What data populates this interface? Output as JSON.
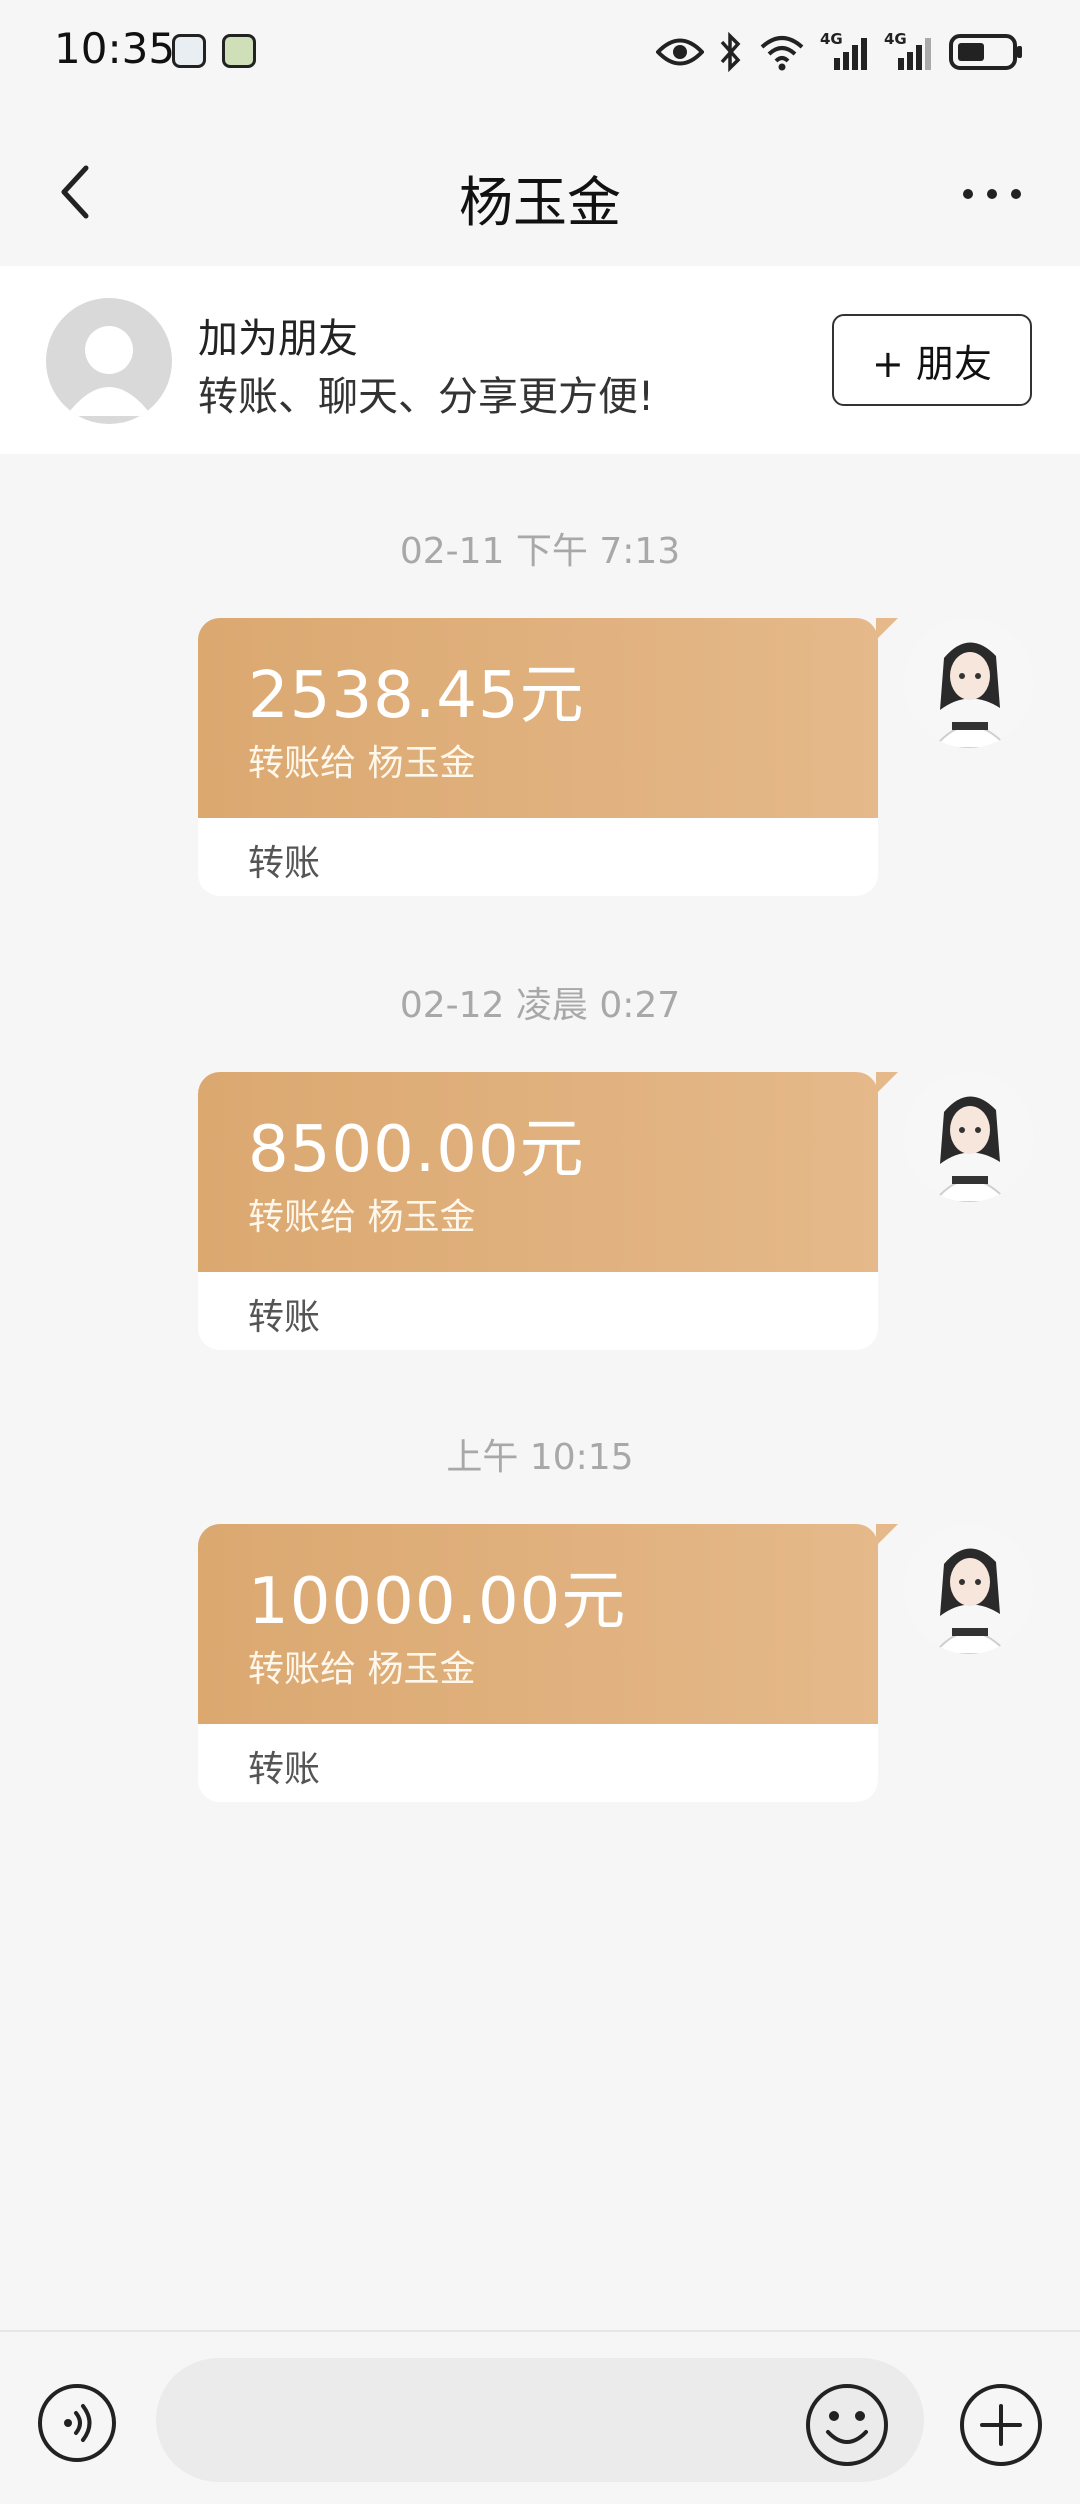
{
  "status_bar": {
    "time": "10:35",
    "network1": "4G",
    "network2": "4G"
  },
  "nav": {
    "title": "杨玉金"
  },
  "friend_banner": {
    "title": "加为朋友",
    "subtitle": "转账、聊天、分享更方便!",
    "button_label": "+ 朋友"
  },
  "messages": [
    {
      "timestamp": "02-11 下午 7:13",
      "amount": "2538.45元",
      "recipient": "转账给 杨玉金",
      "type": "转账"
    },
    {
      "timestamp": "02-12 凌晨 0:27",
      "amount": "8500.00元",
      "recipient": "转账给 杨玉金",
      "type": "转账"
    },
    {
      "timestamp": "上午 10:15",
      "amount": "10000.00元",
      "recipient": "转账给 杨玉金",
      "type": "转账"
    }
  ],
  "input_bar": {
    "placeholder": ""
  },
  "colors": {
    "card_gradient_start": "#dba870",
    "card_gradient_end": "#e5b98a",
    "background": "#f6f6f6"
  },
  "icons": [
    "back-icon",
    "more-icon",
    "voice-icon",
    "emoji-icon",
    "plus-icon",
    "eye-icon",
    "bluetooth-icon",
    "wifi-icon",
    "signal-icon",
    "battery-icon"
  ]
}
